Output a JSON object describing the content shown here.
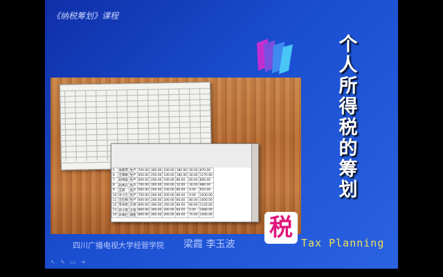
{
  "slide": {
    "course_label": "《纳税筹划》课程",
    "title_chars": [
      "个",
      "人",
      "所",
      "得",
      "税",
      "的",
      "筹",
      "划"
    ],
    "tax_badge": "税",
    "tax_planning": "Tax  Planning",
    "school": "四川广播电视大学经管学院",
    "authors": "梁霞  李玉波"
  },
  "spreadsheet_rows": [
    [
      "5",
      "张春萍",
      "生产",
      "700.00",
      "300.00",
      "100.00",
      "180.00",
      "30.00",
      "870.00"
    ],
    [
      "6",
      "王晓娟",
      "生产",
      "650.00",
      "250.00",
      "100.00",
      "180.00",
      "30.00",
      "1170.00"
    ],
    [
      "7",
      "赵阳面",
      "生产",
      "600.00",
      "200.00",
      "100.00",
      "80.00",
      "60.00",
      "800.00"
    ],
    [
      "8",
      "赵秀兵",
      "生产",
      "700.00",
      "300.00",
      "100.00",
      "10.00",
      "30.00",
      "980.00"
    ],
    [
      "9",
      "王刚",
      "生产",
      "600.00",
      "200.00",
      "100.00",
      "80.00",
      "0.00",
      "920.00"
    ],
    [
      "10",
      "许小兰",
      "生产",
      "750.00",
      "200.00",
      "200.00",
      "80.00",
      "0.00",
      "1030.00"
    ],
    [
      "11",
      "王红梅",
      "生产",
      "600.00",
      "200.00",
      "200.00",
      "80.00",
      "80.00",
      "1000.00"
    ],
    [
      "12",
      "李光明",
      "企划",
      "800.00",
      "300.00",
      "200.00",
      "80.00",
      "80.00",
      "1120.00"
    ],
    [
      "13",
      "孙小燕",
      "企划",
      "800.00",
      "300.00",
      "200.00",
      "60.00",
      "0.00",
      "1080.00"
    ],
    [
      "14",
      "孙青红",
      "销售",
      "800.00",
      "300.00",
      "200.00",
      "80.00",
      "70.00",
      "1040.00"
    ]
  ],
  "colors": {
    "slide_bg": "#1a4ed0",
    "title": "#ffffff",
    "badge_text": "#e0167b",
    "tax_planning": "#f3e25a"
  },
  "controls": [
    "arrow-icon",
    "pen-icon",
    "menu-icon",
    "next-icon"
  ]
}
